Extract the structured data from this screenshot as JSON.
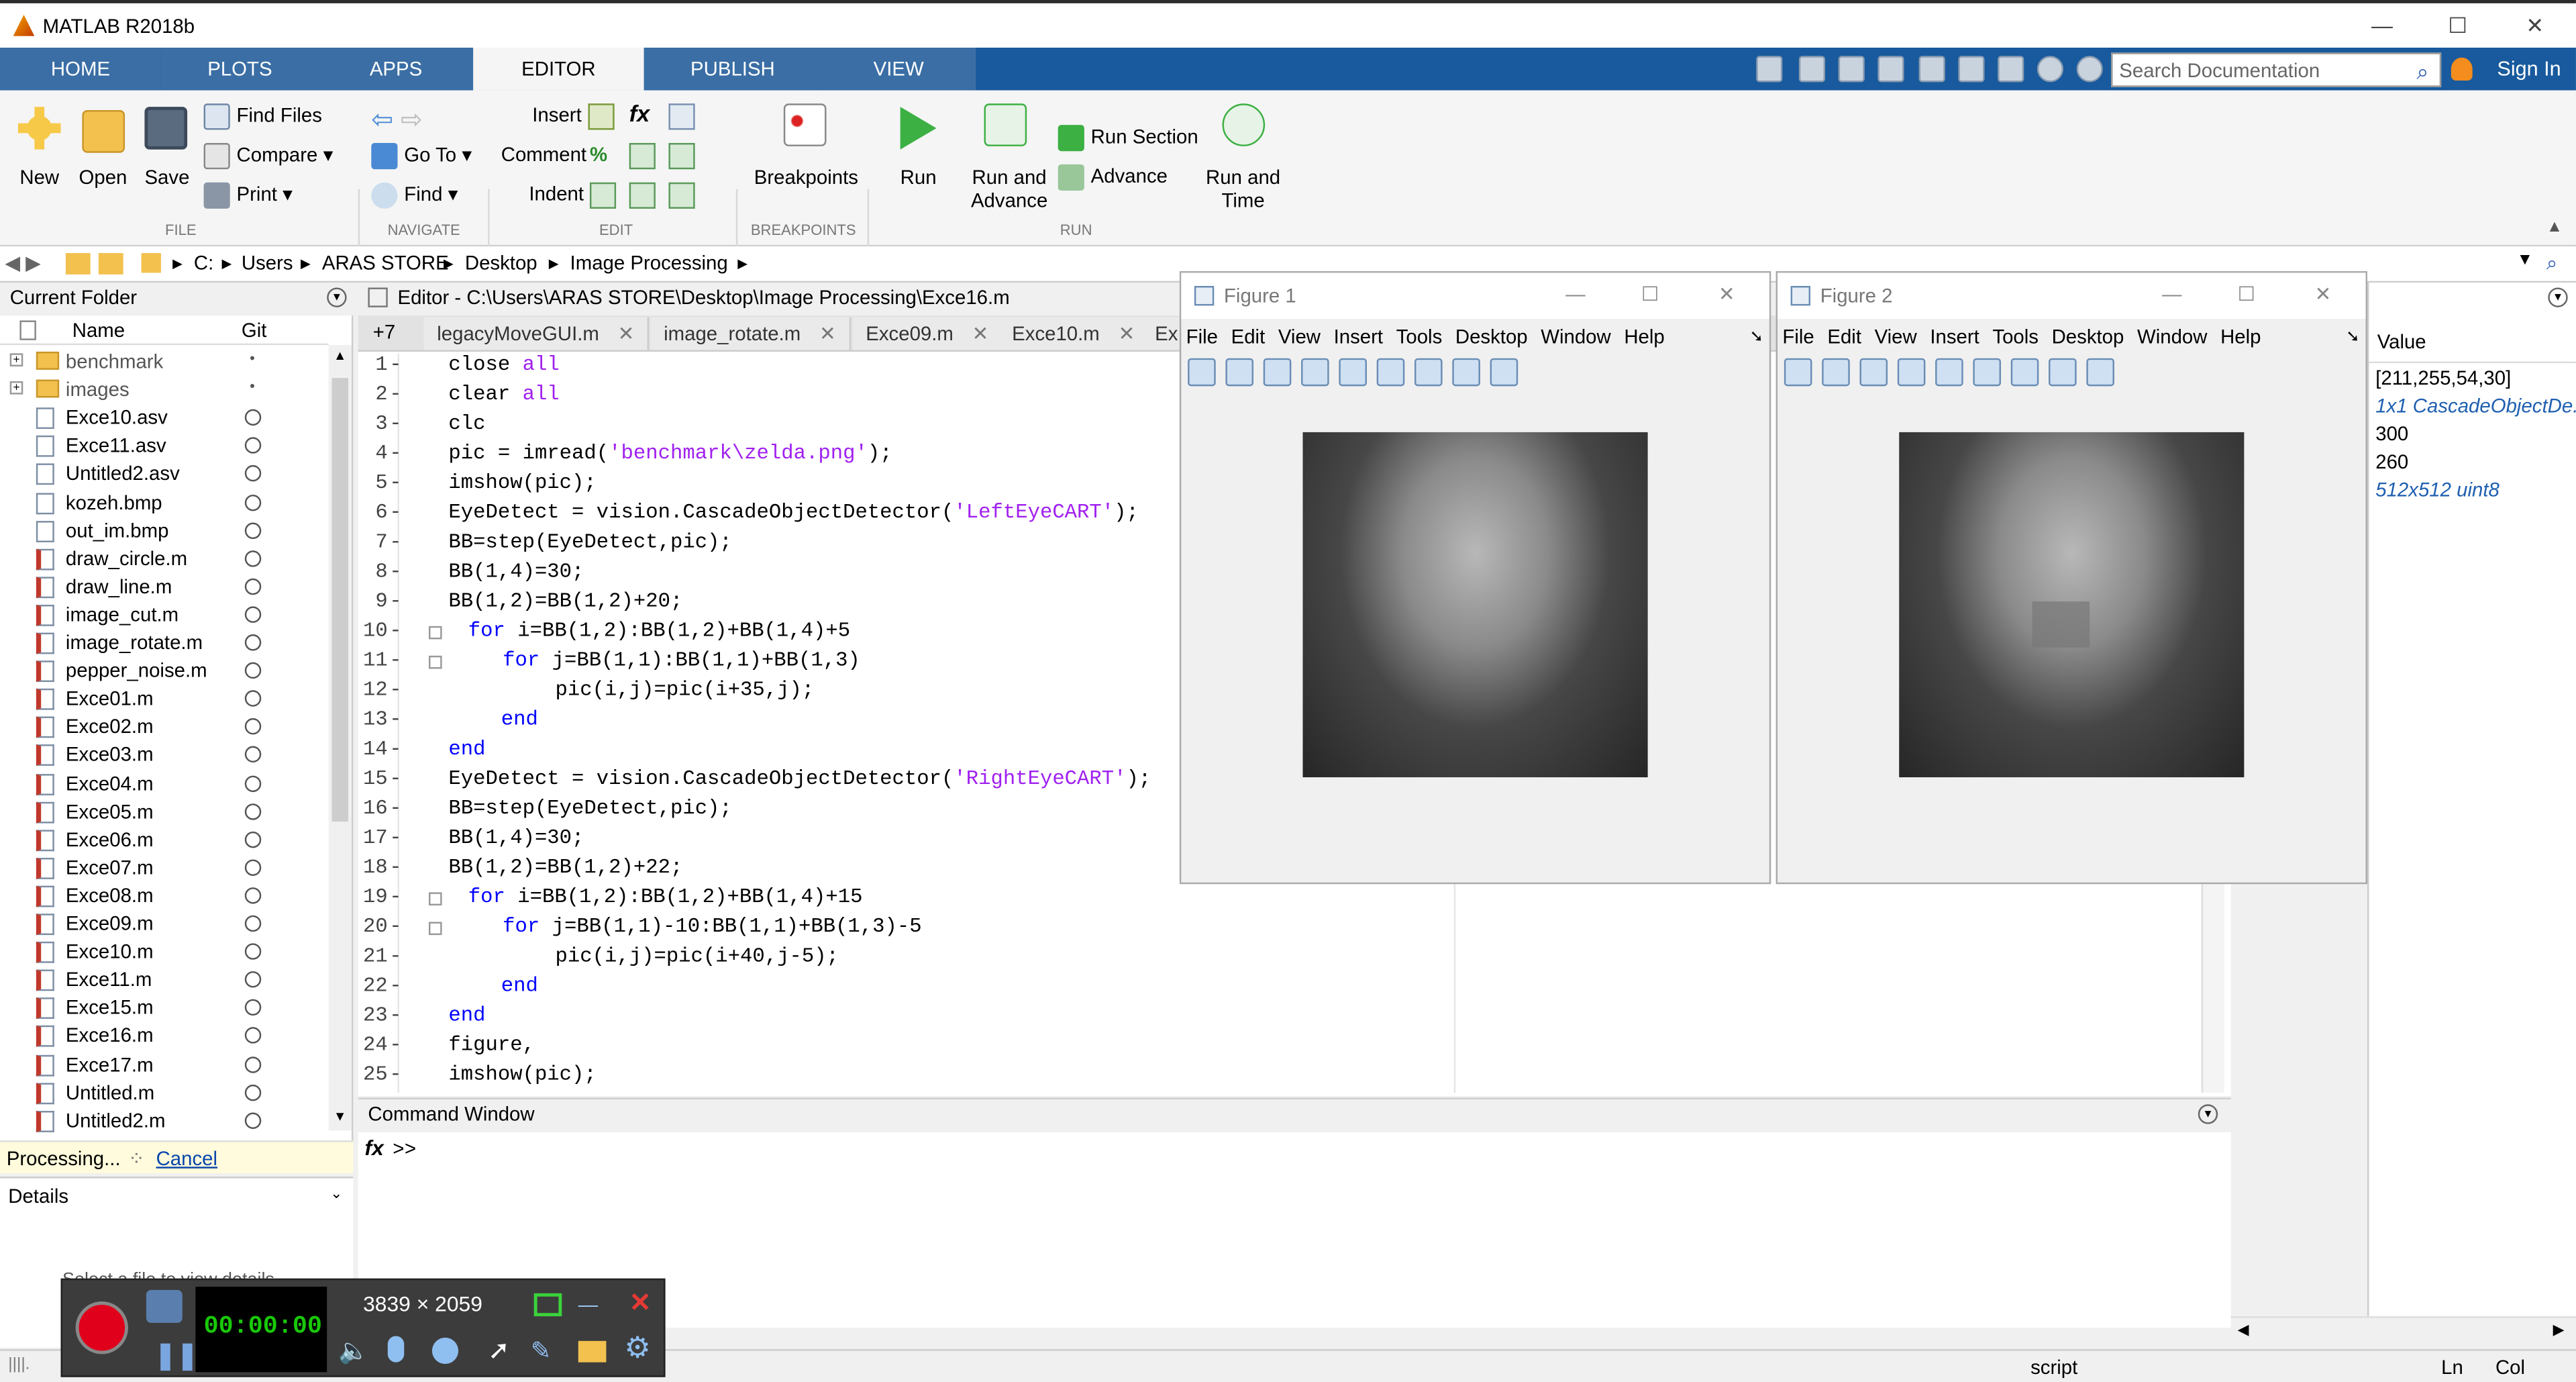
{
  "window": {
    "title": "MATLAB R2018b"
  },
  "tabs": [
    "HOME",
    "PLOTS",
    "APPS",
    "EDITOR",
    "PUBLISH",
    "VIEW"
  ],
  "search": {
    "placeholder": "Search Documentation"
  },
  "sign_in": "Sign In",
  "ribbon": {
    "new": "New",
    "open": "Open",
    "save": "Save",
    "find_files": "Find Files",
    "compare": "Compare",
    "print": "Print",
    "go_to": "Go To",
    "find": "Find",
    "insert": "Insert",
    "comment": "Comment",
    "indent": "Indent",
    "breakpoints": "Breakpoints",
    "run": "Run",
    "run_and_advance": "Run and\nAdvance",
    "run_section": "Run Section",
    "advance": "Advance",
    "run_and_time": "Run and\nTime",
    "sections": {
      "file": "FILE",
      "navigate": "NAVIGATE",
      "edit": "EDIT",
      "breakpoints": "BREAKPOINTS",
      "run": "RUN"
    }
  },
  "address": [
    "C:",
    "Users",
    "ARAS STORE",
    "Desktop",
    "Image Processing"
  ],
  "current_folder": {
    "title": "Current Folder",
    "col_name": "Name",
    "col_git": "Git",
    "items": [
      "benchmark",
      "images",
      "Exce10.asv",
      "Exce11.asv",
      "Untitled2.asv",
      "kozeh.bmp",
      "out_im.bmp",
      "draw_circle.m",
      "draw_line.m",
      "image_cut.m",
      "image_rotate.m",
      "pepper_noise.m",
      "Exce01.m",
      "Exce02.m",
      "Exce03.m",
      "Exce04.m",
      "Exce05.m",
      "Exce06.m",
      "Exce07.m",
      "Exce08.m",
      "Exce09.m",
      "Exce10.m",
      "Exce11.m",
      "Exce15.m",
      "Exce16.m",
      "Exce17.m",
      "Untitled.m",
      "Untitled2.m"
    ],
    "processing": "Processing...",
    "cancel": "Cancel",
    "details": "Details",
    "details_hint": "Select a file to view details"
  },
  "editor": {
    "title": "Editor - C:\\Users\\ARAS STORE\\Desktop\\Image Processing\\Exce16.m",
    "add_tab": "+7",
    "tabs": [
      "legacyMoveGUI.m",
      "image_rotate.m",
      "Exce09.m",
      "Exce10.m",
      "Ex"
    ],
    "lines": [
      "1",
      "2",
      "3",
      "4",
      "5",
      "6",
      "7",
      "8",
      "9",
      "10",
      "11",
      "12",
      "13",
      "14",
      "15",
      "16",
      "17",
      "18",
      "19",
      "20",
      "21",
      "22",
      "23",
      "24",
      "25"
    ]
  },
  "command_window": {
    "title": "Command Window",
    "prompt": ">>"
  },
  "figures": [
    {
      "title": "Figure 1"
    },
    {
      "title": "Figure 2"
    }
  ],
  "figure_menu": [
    "File",
    "Edit",
    "View",
    "Insert",
    "Tools",
    "Desktop",
    "Window",
    "Help"
  ],
  "workspace": {
    "col_value": "Value",
    "values": [
      "[211,255,54,30]",
      "1x1 CascadeObjectDe...",
      "300",
      "260",
      "512x512 uint8"
    ]
  },
  "status": {
    "script": "script",
    "ln": "Ln",
    "col": "Col"
  },
  "recorder": {
    "resolution": "3839 × 2059",
    "timer": "00:00:00"
  },
  "colors": {
    "tabstrip": "#185a9d",
    "keyword": "#0000ff",
    "string": "#a020f0"
  }
}
